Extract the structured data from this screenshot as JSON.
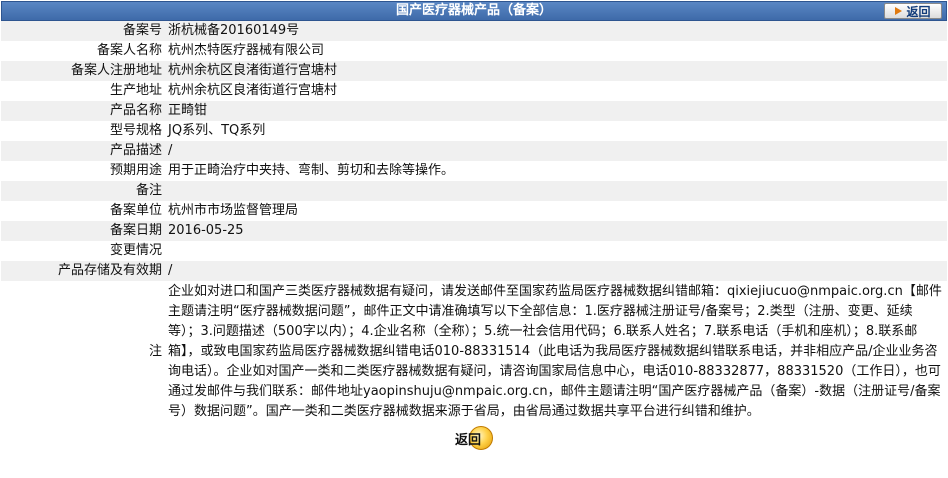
{
  "header": {
    "title": "国产医疗器械产品（备案）",
    "back_label": "返回"
  },
  "rows": [
    {
      "label": "备案号",
      "value": "浙杭械备20160149号"
    },
    {
      "label": "备案人名称",
      "value": "杭州杰特医疗器械有限公司"
    },
    {
      "label": "备案人注册地址",
      "value": "杭州余杭区良渚街道行宫塘村"
    },
    {
      "label": "生产地址",
      "value": "杭州余杭区良渚街道行宫塘村"
    },
    {
      "label": "产品名称",
      "value": "正畸钳"
    },
    {
      "label": "型号规格",
      "value": "JQ系列、TQ系列"
    },
    {
      "label": "产品描述",
      "value": "/"
    },
    {
      "label": "预期用途",
      "value": "用于正畸治疗中夹持、弯制、剪切和去除等操作。"
    },
    {
      "label": "备注",
      "value": ""
    },
    {
      "label": "备案单位",
      "value": "杭州市市场监督管理局"
    },
    {
      "label": "备案日期",
      "value": "2016-05-25"
    },
    {
      "label": "变更情况",
      "value": ""
    },
    {
      "label": "产品存储及有效期",
      "value": "/"
    }
  ],
  "note": {
    "label": "注",
    "text": "企业如对进口和国产三类医疗器械数据有疑问，请发送邮件至国家药监局医疗器械数据纠错邮箱：qixiejiucuo@nmpaic.org.cn【邮件主题请注明“医疗器械数据问题”，邮件正文中请准确填写以下全部信息：1.医疗器械注册证号/备案号；2.类型（注册、变更、延续等）；3.问题描述（500字以内）；4.企业名称（全称）；5.统一社会信用代码；6.联系人姓名；7.联系电话（手机和座机）；8.联系邮箱】，或致电国家药监局医疗器械数据纠错电话010-88331514（此电话为我局医疗器械数据纠错联系电话，并非相应产品/企业业务咨询电话）。企业如对国产一类和二类医疗器械数据有疑问，请咨询国家局信息中心，电话010-88332877，88331520（工作日），也可通过发邮件与我们联系：邮件地址yaopinshuju@nmpaic.org.cn，邮件主题请注明“国产医疗器械产品（备案）-数据（注册证号/备案号）数据问题”。国产一类和二类医疗器械数据来源于省局，由省局通过数据共享平台进行纠错和维护。"
  },
  "footer": {
    "back_label": "返回"
  }
}
